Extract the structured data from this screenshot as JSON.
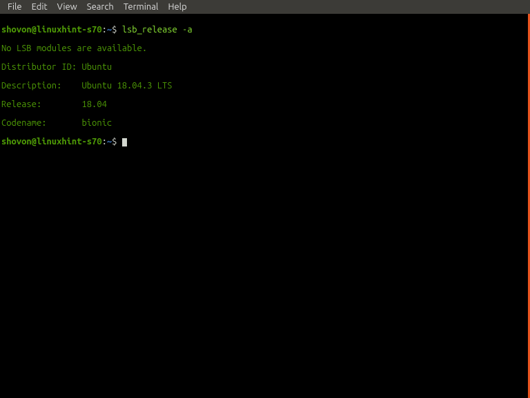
{
  "menubar": {
    "items": [
      "File",
      "Edit",
      "View",
      "Search",
      "Terminal",
      "Help"
    ]
  },
  "terminal": {
    "prompt1": {
      "userhost": "shovon@linuxhint-s70",
      "sep": ":",
      "path": "~",
      "dollar": "$"
    },
    "command1": "lsb_release -a",
    "output": {
      "line1": "No LSB modules are available.",
      "line2": "Distributor ID: Ubuntu",
      "line3": "Description:    Ubuntu 18.04.3 LTS",
      "line4": "Release:        18.04",
      "line5": "Codename:       bionic"
    },
    "prompt2": {
      "userhost": "shovon@linuxhint-s70",
      "sep": ":",
      "path": "~",
      "dollar": "$"
    }
  }
}
